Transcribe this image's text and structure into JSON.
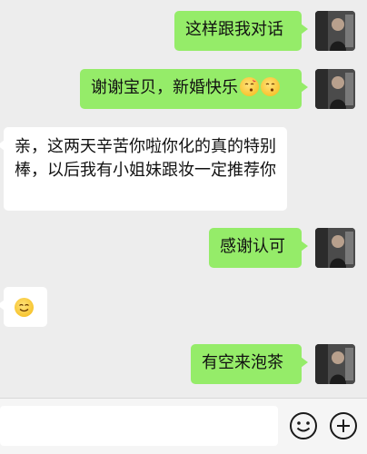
{
  "messages": [
    {
      "side": "out",
      "text": "这样跟我对话",
      "emoji": []
    },
    {
      "side": "out",
      "text": "谢谢宝贝，新婚快乐",
      "emoji": [
        "kissing-face-emoji",
        "kissing-face-emoji"
      ]
    },
    {
      "side": "in",
      "text": "亲，这两天辛苦你啦你化的真的特别棒，以后我有小姐妹跟妆一定推荐你",
      "emoji": []
    },
    {
      "side": "out",
      "text": "感谢认可",
      "emoji": []
    },
    {
      "side": "in",
      "text": "",
      "emoji": [
        "smiling-face-emoji"
      ]
    },
    {
      "side": "out",
      "text": "有空来泡茶",
      "emoji": []
    }
  ],
  "input_bar": {
    "input_value": "",
    "icons": [
      "emoji-picker-icon",
      "plus-icon"
    ]
  },
  "colors": {
    "chat_background": "#ededed",
    "outgoing_bubble": "#95ec69",
    "incoming_bubble": "#ffffff",
    "input_bar_background": "#f5f5f5"
  }
}
